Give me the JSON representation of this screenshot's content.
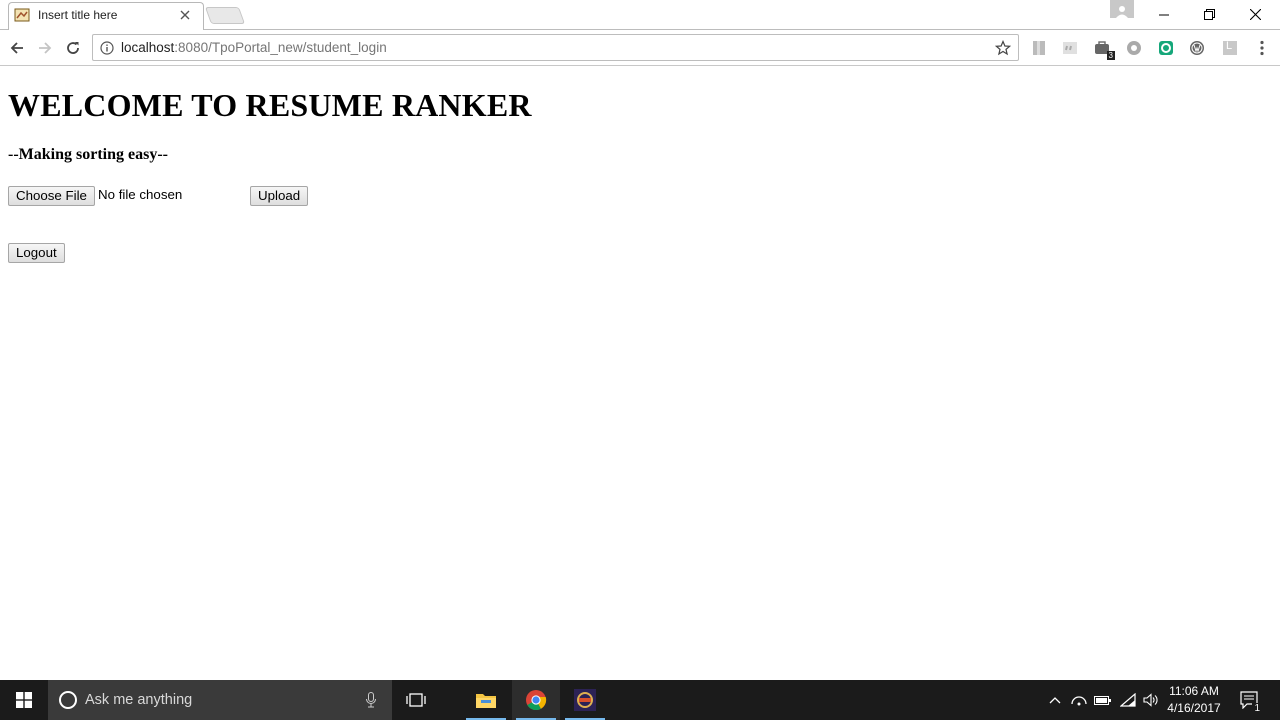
{
  "browser": {
    "tab_title": "Insert title here",
    "url_host": "localhost",
    "url_rest": ":8080/TpoPortal_new/student_login",
    "extension_badge": "3",
    "extension_letter": "L"
  },
  "page": {
    "heading": "WELCOME TO RESUME RANKER",
    "tagline": "--Making sorting easy--",
    "choose_file_label": "Choose File",
    "no_file_text": "No file chosen",
    "upload_label": "Upload",
    "logout_label": "Logout"
  },
  "taskbar": {
    "search_placeholder": "Ask me anything",
    "time": "11:06 AM",
    "date": "4/16/2017",
    "notification_count": "1"
  },
  "colors": {
    "taskbar_bg": "#1b1b1b",
    "taskbar_accent": "#76b9ed",
    "link_gray": "#767676"
  },
  "icons": [
    "page-favicon",
    "tab-close-icon",
    "profile-icon",
    "minimize-icon",
    "restore-icon",
    "close-window-icon",
    "back-arrow-icon",
    "forward-arrow-icon",
    "reload-icon",
    "info-icon",
    "bookmark-star-icon",
    "menu-dots-icon",
    "windows-start-icon",
    "cortana-icon",
    "microphone-icon",
    "task-view-icon",
    "file-explorer-icon",
    "chrome-icon",
    "java-ee-icon",
    "chevron-up-icon",
    "network-icon",
    "battery-icon",
    "wifi-icon",
    "volume-icon",
    "action-center-icon"
  ]
}
